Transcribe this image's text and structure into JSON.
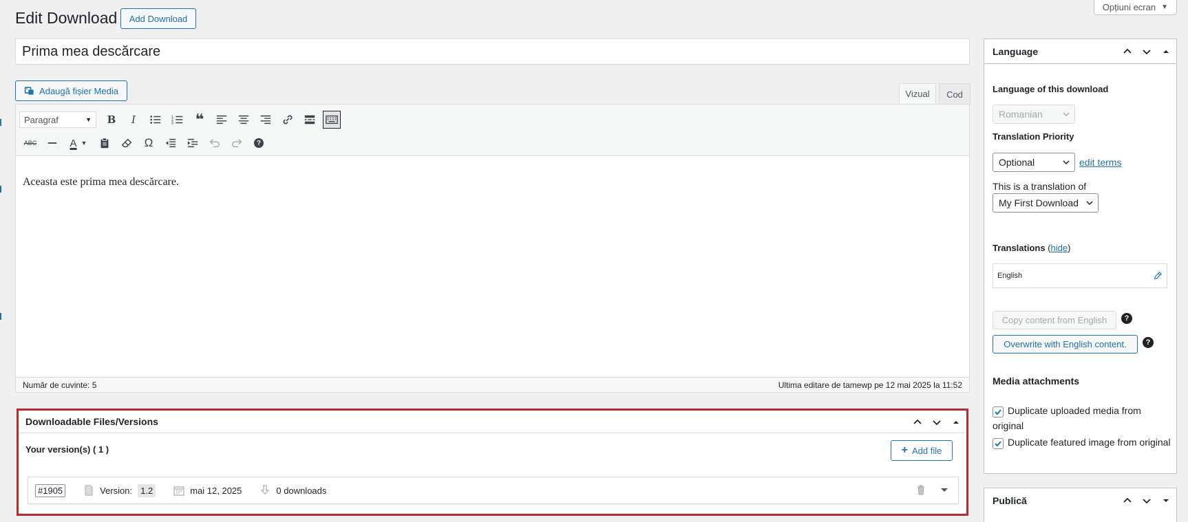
{
  "header": {
    "title": "Edit Download",
    "add_button": "Add Download",
    "screen_options": "Opțiuni ecran"
  },
  "post": {
    "title": "Prima mea descărcare"
  },
  "editor": {
    "media_button": "Adaugă fișier Media",
    "tab_visual": "Vizual",
    "tab_code": "Cod",
    "format_select": "Paragraf",
    "content": "Aceasta este prima mea descărcare.",
    "word_count": "Număr de cuvinte: 5",
    "last_edit": "Ultima editare de tamewp pe 12 mai 2025 la 11:52"
  },
  "downloads": {
    "box_title": "Downloadable Files/Versions",
    "versions_label": "Your version(s) ( 1 )",
    "add_file": "Add file",
    "version": {
      "id": "#1905",
      "version_label": "Version:",
      "version_value": "1.2",
      "date": "mai 12, 2025",
      "downloads": "0 downloads"
    }
  },
  "language_box": {
    "title": "Language",
    "lang_label": "Language of this download",
    "lang_value": "Romanian",
    "priority_label": "Translation Priority",
    "priority_value": "Optional",
    "edit_terms": "edit terms",
    "translation_of_label": "This is a translation of",
    "translation_of_value": "My First Download",
    "translations_label": "Translations",
    "hide": "hide",
    "translation_entry": "English",
    "copy_button": "Copy content from English",
    "overwrite_button": "Overwrite with English content.",
    "media_label": "Media attachments",
    "dup_media": "Duplicate uploaded media from original",
    "dup_featured": "Duplicate featured image from original"
  },
  "publish_box": {
    "title": "Publică"
  },
  "colors": {
    "accent": "#2271b1",
    "highlight_border": "#b32d2e",
    "background": "#f0f0f1"
  }
}
